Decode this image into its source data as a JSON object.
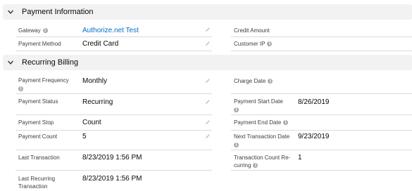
{
  "payment_information": {
    "title": "Payment Information",
    "gateway": {
      "label": "Gateway",
      "value": "Authorize.net Test"
    },
    "payment_method": {
      "label": "Payment Method",
      "value": "Credit Card"
    },
    "credit_amount": {
      "label": "Credit Amount",
      "value": ""
    },
    "customer_ip": {
      "label": "Customer IP",
      "value": ""
    }
  },
  "recurring_billing": {
    "title": "Recurring Billing",
    "payment_frequency": {
      "label": "Payment Frequency",
      "value": "Monthly"
    },
    "payment_status": {
      "label": "Payment Status",
      "value": "Recurring"
    },
    "payment_stop": {
      "label": "Payment Stop",
      "value": "Count"
    },
    "payment_count": {
      "label": "Payment Count",
      "value": "5"
    },
    "last_transaction": {
      "label": "Last Transaction",
      "value": "8/23/2019 1:56 PM"
    },
    "last_recurring_transaction": {
      "label_line1": "Last Recurring",
      "label_line2": "Transaction",
      "value": "8/23/2019 1:56 PM"
    },
    "charge_date": {
      "label": "Charge Date",
      "value": ""
    },
    "payment_start_date": {
      "label": "Payment Start Date",
      "value": "8/26/2019"
    },
    "payment_end_date": {
      "label": "Payment End Date",
      "value": ""
    },
    "next_transaction_date": {
      "label": "Next Transaction Date",
      "value": "9/23/2019"
    },
    "transaction_count_recurring": {
      "label_line1": "Transaction Count Re-",
      "label_line2": "curring",
      "value": "1"
    }
  },
  "icons": {
    "info": "i",
    "chevron": "chevron-down-icon",
    "edit": "pencil-icon"
  },
  "colors": {
    "link": "#006dcc",
    "header_bg": "#f3f2f2",
    "divider": "#dddbda"
  }
}
